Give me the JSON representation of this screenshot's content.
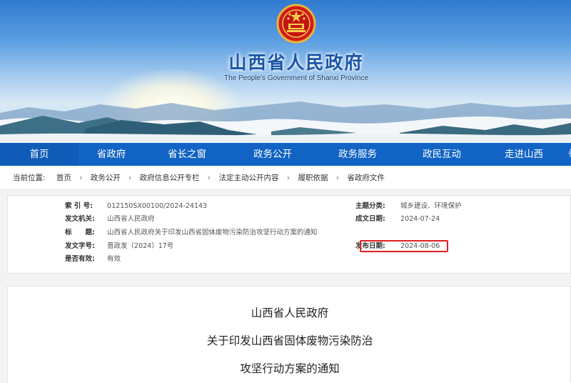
{
  "header": {
    "title": "山西省人民政府",
    "subtitle": "The People's Government of Shanxi Province",
    "emblem_icon": "national-emblem-icon"
  },
  "nav": {
    "items": [
      "首页",
      "省政府",
      "省长之窗",
      "政务公开",
      "政务服务",
      "政民互动",
      "走进山西"
    ],
    "more": "《"
  },
  "breadcrumb": {
    "label": "当前位置:",
    "items": [
      "首页",
      "政务公开",
      "政府信息公开专栏",
      "法定主动公开内容",
      "履职依据",
      "省政府文件"
    ],
    "separator": "›"
  },
  "info": {
    "index_label": "索 引 号:",
    "index_value": "012150SX00100/2024-24143",
    "topic_label": "主题分类:",
    "topic_value": "城乡建设、环境保护",
    "issuer_label": "发文机关:",
    "issuer_value": "山西省人民政府",
    "date_made_label": "成文日期:",
    "date_made_value": "2024-07-24",
    "title_label": "标　　题:",
    "title_value": "山西省人民政府关于印发山西省固体废物污染防治攻坚行动方案的通知",
    "docno_label": "发文字号:",
    "docno_value": "晋政发〔2024〕17号",
    "publish_label": "发布日期:",
    "publish_value": "2024-08-06",
    "valid_label": "是否有效:",
    "valid_value": "有效"
  },
  "content": {
    "line1": "山西省人民政府",
    "line2": "关于印发山西省固体废物污染防治",
    "line3": "攻坚行动方案的通知"
  },
  "colors": {
    "nav_bg": "#1163c4",
    "title_blue": "#1b55a8",
    "highlight_red": "#e02020"
  }
}
